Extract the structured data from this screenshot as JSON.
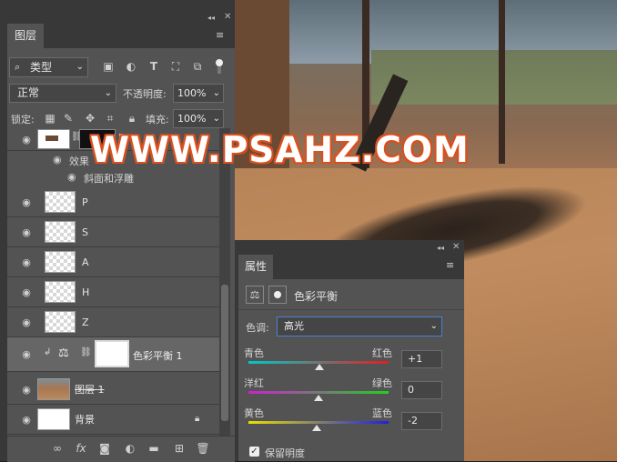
{
  "watermark": "WWW.PSAHZ.COM",
  "layers_panel": {
    "tab": "图层",
    "filter_kind": "类型",
    "blend_mode": "正常",
    "opacity_label": "不透明度:",
    "opacity_value": "100%",
    "lock_label": "锁定:",
    "fill_label": "填充:",
    "fill_value": "100%",
    "effects_label": "效果",
    "effect_bevel": "斜面和浮雕",
    "layers": [
      "P",
      "S",
      "A",
      "H",
      "Z"
    ],
    "adjust_layer": "色彩平衡 1",
    "photo_layer": "图层 1",
    "background_layer": "背景",
    "top_layer_letter": "P"
  },
  "properties_panel": {
    "tab": "属性",
    "title": "色彩平衡",
    "tone_label": "色调:",
    "tone_value": "高光",
    "sliders": [
      {
        "left": "青色",
        "right": "红色",
        "value": "+1",
        "level": 0.505,
        "from": "#00c8c8",
        "to": "#e02020"
      },
      {
        "left": "洋红",
        "right": "绿色",
        "value": "0",
        "level": 0.5,
        "from": "#d020d0",
        "to": "#20d020"
      },
      {
        "left": "黄色",
        "right": "蓝色",
        "value": "-2",
        "level": 0.49,
        "from": "#e8e000",
        "to": "#2020e0"
      }
    ],
    "preserve_label": "保留明度",
    "preserve_checked": true
  }
}
